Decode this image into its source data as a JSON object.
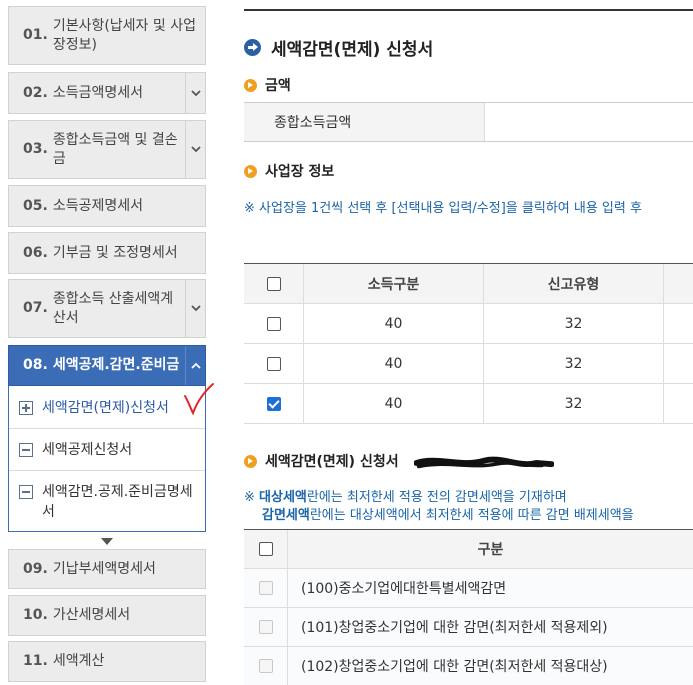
{
  "nav": {
    "steps": [
      {
        "num": "01.",
        "label": "기본사항(납세자 및 사업장정보)"
      },
      {
        "num": "02.",
        "label": "소득금액명세서"
      },
      {
        "num": "03.",
        "label": "종합소득금액 및 결손금"
      },
      {
        "num": "05.",
        "label": "소득공제명세서"
      },
      {
        "num": "06.",
        "label": "기부금 및 조정명세서"
      },
      {
        "num": "07.",
        "label": "종합소득 산출세액계산서"
      },
      {
        "num": "08.",
        "label": "세액공제.감면.준비금"
      },
      {
        "num": "09.",
        "label": "기납부세액명세서"
      },
      {
        "num": "10.",
        "label": "가산세명세서"
      },
      {
        "num": "11.",
        "label": "세액계산"
      }
    ],
    "subitems": [
      {
        "label": "세액감면(면제)신청서",
        "icon": "plus-box-icon"
      },
      {
        "label": "세액공제신청서",
        "icon": "minus-box-icon"
      },
      {
        "label": "세액감면.공제.준비금명세서",
        "icon": "minus-box-icon"
      }
    ]
  },
  "main": {
    "page_title": "세액감면(면제) 신청서",
    "amount_section": {
      "title": "금액",
      "label": "종합소득금액"
    },
    "business_section": {
      "title": "사업장 정보",
      "notice": "※ 사업장을 1건씩 선택 후 [선택내용 입력/수정]을 클릭하여 내용 입력 후",
      "columns": [
        "소득구분",
        "신고유형"
      ],
      "rows": [
        {
          "income_type": "40",
          "report_type": "32",
          "checked": false
        },
        {
          "income_type": "40",
          "report_type": "32",
          "checked": false
        },
        {
          "income_type": "40",
          "report_type": "32",
          "checked": true
        }
      ]
    },
    "reduction_section": {
      "title": "세액감면(면제) 신청서",
      "notice1_prefix": "※ ",
      "notice1_bold": "대상세액",
      "notice1_rest": "란에는 최저한세 적용 전의 감면세액을 기재하며",
      "notice2_bold": "감면세액",
      "notice2_rest": "란에는 대상세액에서 최저한세 적용에 따른 감면 배제세액을",
      "column": "구분",
      "rows": [
        "(100)중소기업에대한특별세액감면",
        "(101)창업중소기업에 대한 감면(최저한세 적용제외)",
        "(102)창업중소기업에 대한 감면(최저한세 적용대상)"
      ]
    }
  },
  "colors": {
    "accent": "#3a6db5",
    "notice": "#1a64a8",
    "icon_orange": "#f0a020",
    "check": "#1e6fd9"
  }
}
